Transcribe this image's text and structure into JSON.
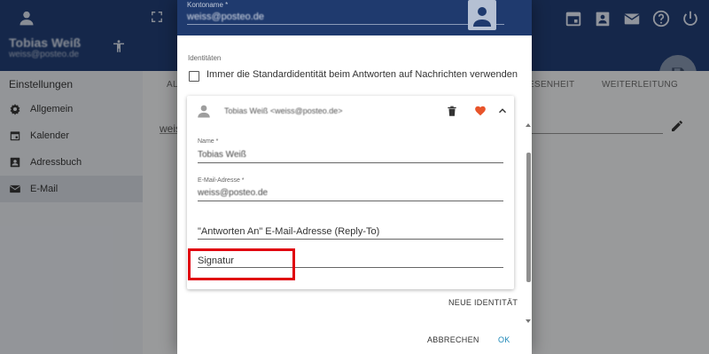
{
  "app": {
    "user_name": "Tobias Weiß",
    "user_email": "weiss@posteo.de"
  },
  "sidebar": {
    "title": "Einstellungen",
    "items": [
      {
        "label": "Allgemein",
        "icon": "gear-icon"
      },
      {
        "label": "Kalender",
        "icon": "calendar-icon"
      },
      {
        "label": "Adressbuch",
        "icon": "contacts-icon"
      },
      {
        "label": "E-Mail",
        "icon": "mail-icon",
        "active": true
      }
    ]
  },
  "main": {
    "tabs": [
      "ALL",
      "ESENHEIT",
      "WEITERLEITUNG"
    ],
    "field_value": "weis"
  },
  "dialog": {
    "header": {
      "label": "Kontoname *",
      "value": "weiss@posteo.de"
    },
    "identities_label": "Identitäten",
    "checkbox_label": "Immer die Standardidentität beim Antworten auf Nachrichten verwenden",
    "checkbox_checked": false,
    "identity": {
      "summary": "Tobias Weiß <weiss@posteo.de>",
      "name_label": "Name *",
      "name_value": "Tobias Weiß",
      "email_label": "E-Mail-Adresse *",
      "email_value": "weiss@posteo.de",
      "reply_to_placeholder": "\"Antworten An\" E-Mail-Adresse (Reply-To)",
      "signature_placeholder": "Signatur"
    },
    "new_identity_button": "NEUE IDENTITÄT",
    "cancel_button": "ABBRECHEN",
    "ok_button": "OK"
  },
  "colors": {
    "header_bg": "#1f3a6e",
    "accent": "#1e88b8",
    "heart": "#e8542a",
    "highlight": "#e0000d"
  }
}
